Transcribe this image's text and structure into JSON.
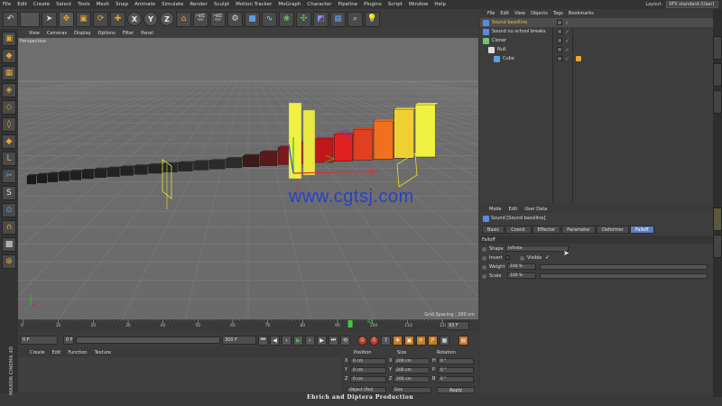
{
  "menubar": {
    "items": [
      "File",
      "Edit",
      "Create",
      "Select",
      "Tools",
      "Mesh",
      "Snap",
      "Animate",
      "Simulate",
      "Render",
      "Sculpt",
      "Motion Tracker",
      "MoGraph",
      "Character",
      "Pipeline",
      "Plugins",
      "Script",
      "Window",
      "Help"
    ],
    "layout_label": "Layout:",
    "layout_value": "VFX standard (User)"
  },
  "toolbar": {
    "axis_x": "X",
    "axis_y": "Y",
    "axis_z": "Z"
  },
  "viewport": {
    "menu": [
      "View",
      "Cameras",
      "Display",
      "Options",
      "Filter",
      "Panel"
    ],
    "label": "Perspective",
    "grid_spacing": "Grid Spacing : 200 cm",
    "watermark": "www.cgtsj.com"
  },
  "timeline": {
    "ticks": [
      "0",
      "10",
      "20",
      "30",
      "40",
      "50",
      "60",
      "70",
      "80",
      "90",
      "100",
      "110",
      "120"
    ],
    "current_frame": "93",
    "end_field": "93 F",
    "playhead_fraction": 0.775
  },
  "playbar": {
    "start": "0 F",
    "field2": "0 F",
    "end": "300 F"
  },
  "materials": {
    "menu": [
      "Create",
      "Edit",
      "Function",
      "Texture"
    ]
  },
  "brand": {
    "line1": "MAXON",
    "line2": "CINEMA 4D"
  },
  "coordinates": {
    "headers": {
      "position": "Position",
      "size": "Size",
      "rotation": "Rotation"
    },
    "rows": [
      {
        "axis": "X",
        "pos": "0 cm",
        "size_axis": "X",
        "size": "200 cm",
        "rot_axis": "H",
        "rot": "0 °"
      },
      {
        "axis": "Y",
        "pos": "0 cm",
        "size_axis": "Y",
        "size": "200 cm",
        "rot_axis": "P",
        "rot": "0 °"
      },
      {
        "axis": "Z",
        "pos": "0 cm",
        "size_axis": "Z",
        "size": "200 cm",
        "rot_axis": "B",
        "rot": "0 °"
      }
    ],
    "mode": "Object (Rel)",
    "size_mode": "Size",
    "apply": "Apply"
  },
  "credit": "Ehrich   and   Diptera  Production",
  "object_manager": {
    "menu": [
      "File",
      "Edit",
      "View",
      "Objects",
      "Tags",
      "Bookmarks"
    ],
    "objects": [
      {
        "name": "Sound basslline",
        "color": "#e8c040",
        "indent": 0,
        "selected": true
      },
      {
        "name": "Sound  nu school breaks",
        "color": "#ddd",
        "indent": 0,
        "selected": false
      },
      {
        "name": "Cloner",
        "color": "#ddd",
        "indent": 0,
        "selected": false
      },
      {
        "name": "Null",
        "color": "#ddd",
        "indent": 1,
        "selected": false
      },
      {
        "name": "Cube",
        "color": "#ddd",
        "indent": 2,
        "selected": false
      }
    ]
  },
  "attributes": {
    "menu": [
      "Mode",
      "Edit",
      "User Data"
    ],
    "title": "Sound [Sound basslline]",
    "tabs": [
      "Basic",
      "Coord.",
      "Effector",
      "Parameter",
      "Deformer",
      "Falloff"
    ],
    "active_tab": "Falloff",
    "section": "Falloff",
    "shape_label": "Shape",
    "shape_value": "Infinite",
    "invert_label": "Invert",
    "visible_label": "Visible",
    "visible_check": "✓",
    "weight_label": "Weight",
    "weight_value": "100 %",
    "scale_label": "Scale",
    "scale_value": "100 %"
  }
}
